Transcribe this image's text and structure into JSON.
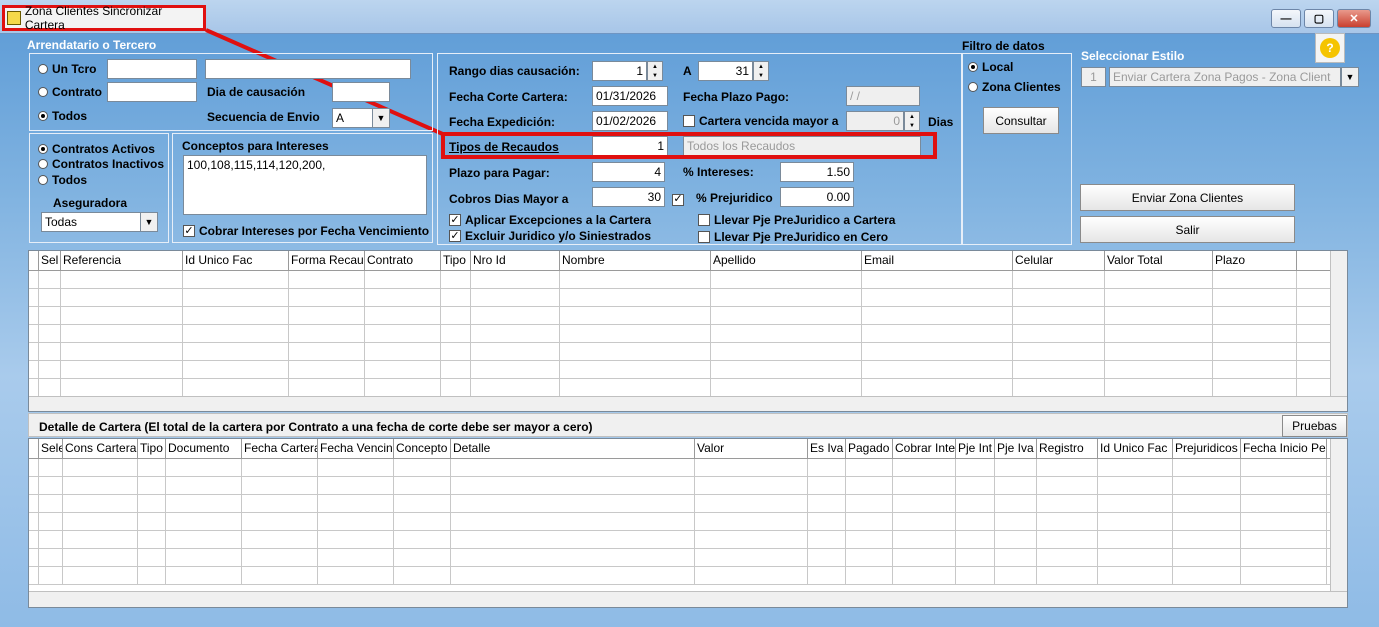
{
  "window": {
    "title": "Zona Clientes Sincronizar Cartera",
    "min": "—",
    "max": "▢",
    "close": "✕"
  },
  "arrendatario": {
    "title": "Arrendatario o Tercero",
    "un_tcro": "Un Tcro",
    "contrato": "Contrato",
    "todos": "Todos",
    "dia_causacion": "Dia de causación",
    "secuencia_envio": "Secuencia de Envio",
    "secuencia_value": "A"
  },
  "contratos": {
    "activos": "Contratos Activos",
    "inactivos": "Contratos Inactivos",
    "todos": "Todos",
    "aseguradora": "Aseguradora",
    "aseguradora_value": "Todas"
  },
  "conceptos": {
    "title": "Conceptos para Intereses",
    "value": "100,108,115,114,120,200,",
    "cobrar": "Cobrar Intereses por Fecha Vencimiento"
  },
  "form": {
    "rango_label": "Rango dias causación:",
    "rango_from": "1",
    "a_label": "A",
    "rango_to": "31",
    "fecha_corte_label": "Fecha Corte Cartera:",
    "fecha_corte": "01/31/2026",
    "fecha_plazo_label": "Fecha Plazo Pago:",
    "fecha_plazo": "/ /",
    "fecha_exp_label": "Fecha Expedición:",
    "fecha_exp": "01/02/2026",
    "cartera_vencida_label": "Cartera vencida mayor a",
    "cartera_vencida": "0",
    "dias_label": "Dias",
    "tipos_label": "Tipos de Recaudos",
    "tipos_value": "1",
    "tipos_desc": "Todos los Recaudos",
    "plazo_label": "Plazo para Pagar:",
    "plazo_value": "4",
    "intereses_label": "% Intereses:",
    "intereses_value": "1.50",
    "cobros_label": "Cobros Dias Mayor a",
    "cobros_value": "30",
    "prejuridico_label": "% Prejuridico",
    "prejuridico_value": "0.00",
    "aplicar": "Aplicar Excepciones a la Cartera",
    "excluir": "Excluir Juridico y/o Siniestrados",
    "llevar_cartera": "Llevar Pje PreJuridico a Cartera",
    "llevar_cero": "Llevar Pje PreJuridico en Cero"
  },
  "filtro": {
    "title": "Filtro de datos",
    "local": "Local",
    "zona": "Zona Clientes",
    "consultar": "Consultar"
  },
  "estilo": {
    "title": "Seleccionar Estilo",
    "num": "1",
    "value": "Enviar Cartera Zona Pagos - Zona Client"
  },
  "actions": {
    "enviar": "Enviar Zona Clientes",
    "salir": "Salir",
    "pruebas": "Pruebas"
  },
  "help_icon": "?",
  "grid1": {
    "columns": [
      "Sel",
      "Referencia",
      "Id Unico Fac",
      "Forma Recau",
      "Contrato",
      "Tipo",
      "Nro Id",
      "Nombre",
      "Apellido",
      "Email",
      "Celular",
      "Valor Total",
      "Plazo"
    ]
  },
  "detalle": {
    "title": "Detalle de Cartera (El total de la cartera por Contrato a una fecha de corte debe ser mayor a cero)"
  },
  "grid2": {
    "columns": [
      "Sele",
      "Cons Cartera",
      "Tipo",
      "Documento",
      "Fecha Cartera",
      "Fecha Vencin",
      "Concepto",
      "Detalle",
      "Valor",
      "Es Iva",
      "Pagado",
      "Cobrar Inte",
      "Pje Int",
      "Pje Iva",
      "Registro",
      "Id Unico Fac",
      "Prejuridicos",
      "Fecha Inicio Pe"
    ]
  }
}
